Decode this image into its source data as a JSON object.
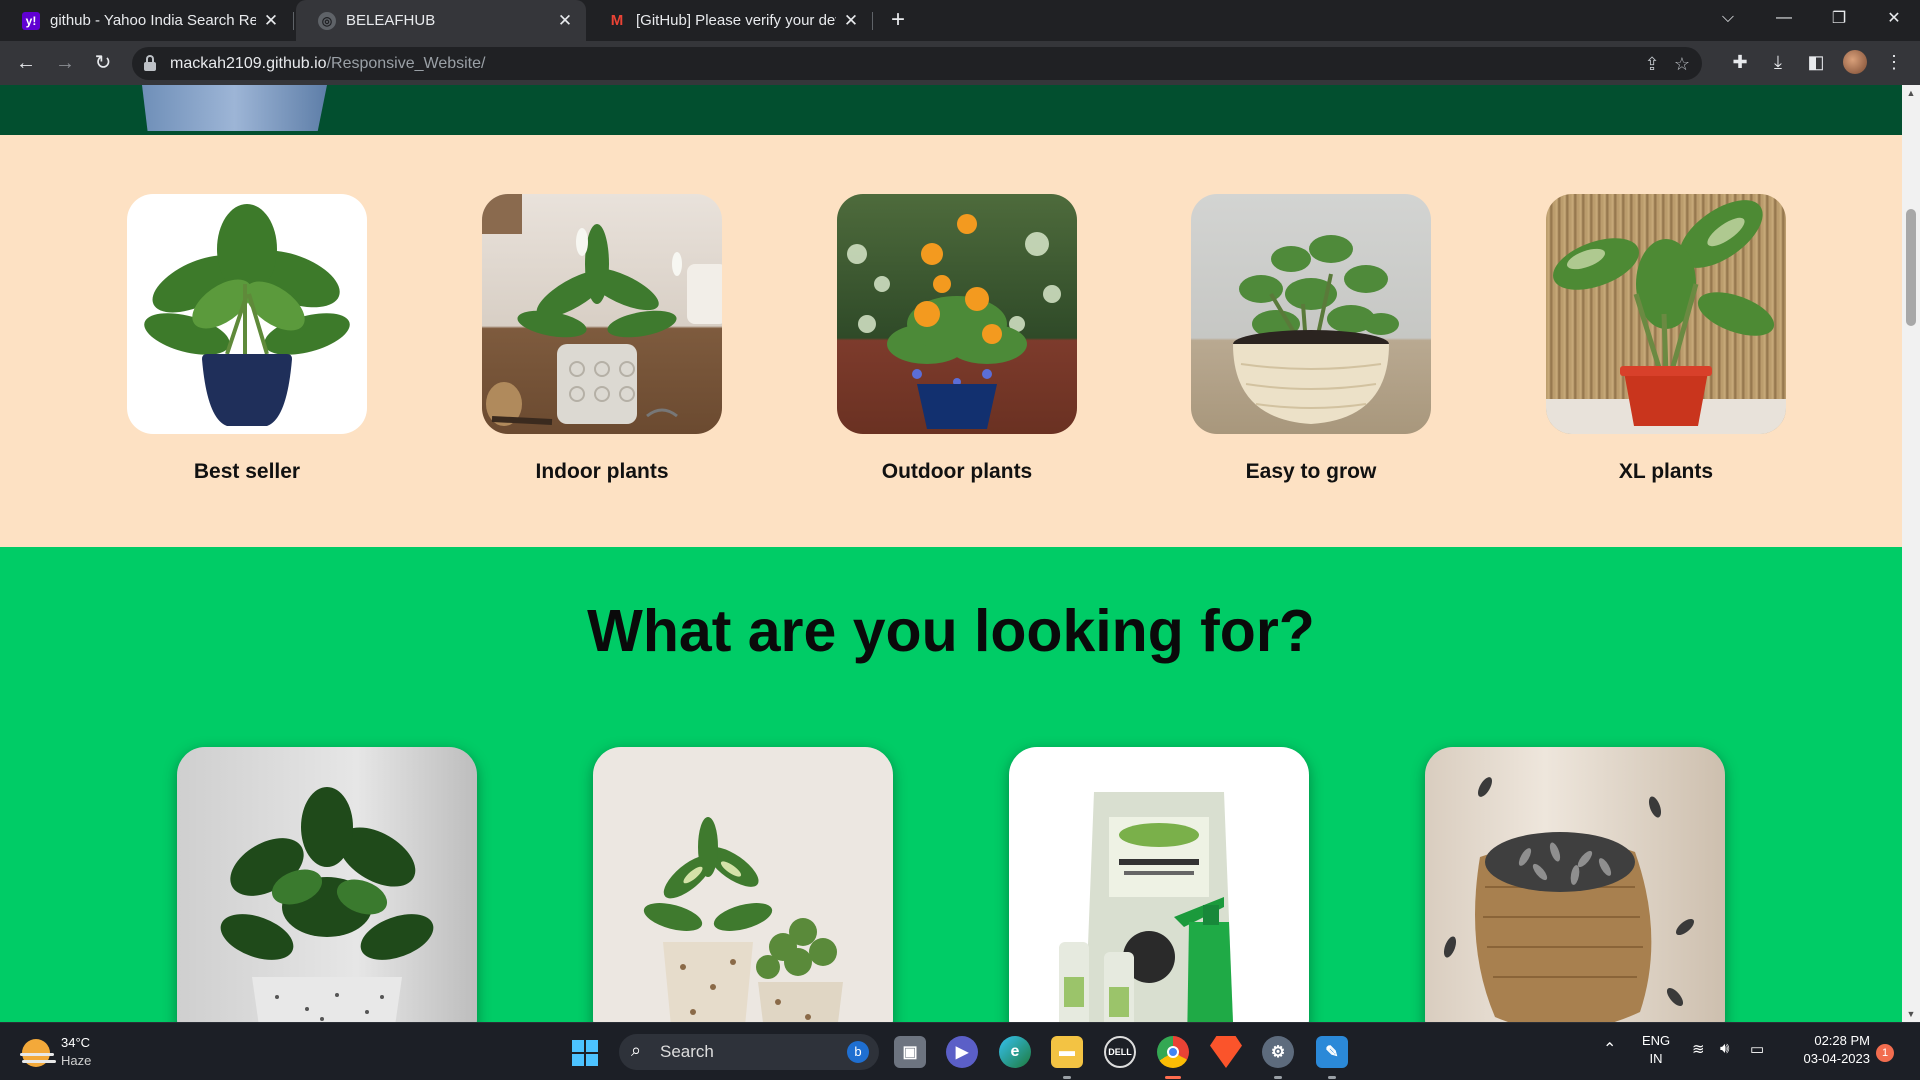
{
  "browser": {
    "tabs": [
      {
        "title": "github - Yahoo India Search Resu",
        "favicon": "yahoo-icon",
        "active": false
      },
      {
        "title": "BELEAFHUB",
        "favicon": "globe-icon",
        "active": true
      },
      {
        "title": "[GitHub] Please verify your devic",
        "favicon": "gmail-icon",
        "active": false
      }
    ],
    "url_host": "mackah2109.github.io",
    "url_path": "/Responsive_Website/"
  },
  "categories": [
    {
      "label": "Best seller"
    },
    {
      "label": "Indoor plants"
    },
    {
      "label": "Outdoor plants"
    },
    {
      "label": "Easy to grow"
    },
    {
      "label": "XL plants"
    }
  ],
  "looking": {
    "title": "What are you looking for?",
    "cards": [
      "money-plant-image",
      "indoor-plants-image",
      "fertilizer-image",
      "seeds-image"
    ]
  },
  "taskbar": {
    "weather_temp": "34°C",
    "weather_cond": "Haze",
    "search_label": "Search",
    "lang_top": "ENG",
    "lang_bottom": "IN",
    "time": "02:28 PM",
    "date": "03-04-2023",
    "notification_count": "1"
  },
  "colors": {
    "hero_band": "#024f2f",
    "category_bg": "#fde1c3",
    "looking_bg": "#00cc66"
  }
}
